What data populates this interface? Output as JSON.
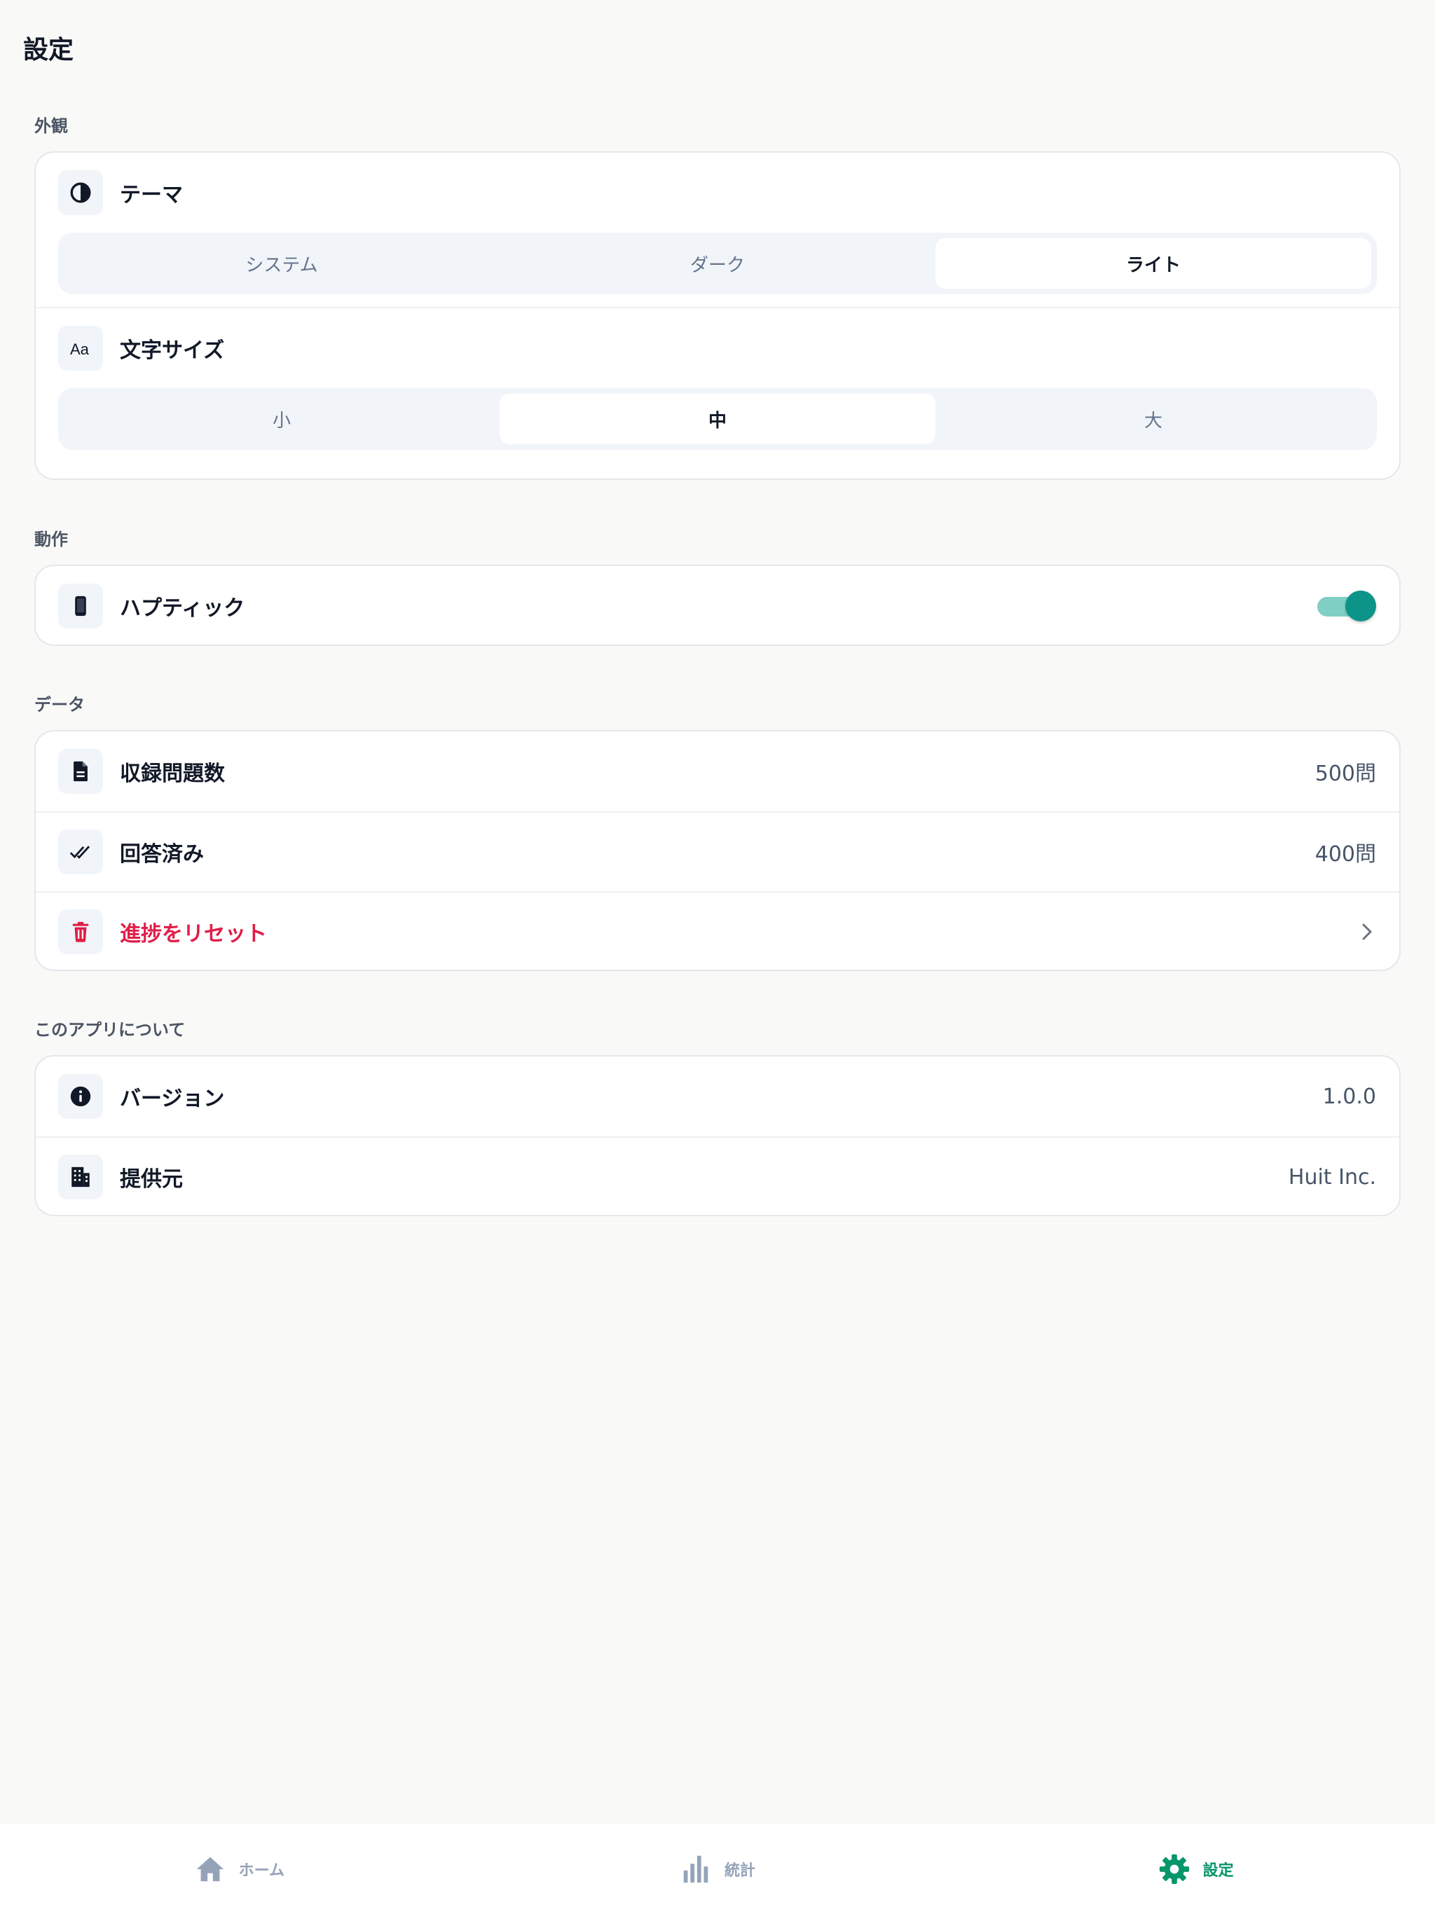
{
  "page": {
    "title": "設定"
  },
  "sections": {
    "appearance": {
      "label": "外観",
      "theme": {
        "label": "テーマ",
        "icon": "contrast-icon",
        "options": [
          "システム",
          "ダーク",
          "ライト"
        ],
        "selected": "ライト"
      },
      "font_size": {
        "label": "文字サイズ",
        "icon": "text-size-icon",
        "options": [
          "小",
          "中",
          "大"
        ],
        "selected": "中"
      }
    },
    "behavior": {
      "label": "動作",
      "haptic": {
        "label": "ハプティック",
        "icon": "phone-icon",
        "enabled": true
      }
    },
    "data": {
      "label": "データ",
      "total": {
        "label": "収録問題数",
        "icon": "document-icon",
        "value": "500問"
      },
      "answered": {
        "label": "回答済み",
        "icon": "double-check-icon",
        "value": "400問"
      },
      "reset": {
        "label": "進捗をリセット",
        "icon": "trash-icon"
      }
    },
    "about": {
      "label": "このアプリについて",
      "version": {
        "label": "バージョン",
        "icon": "info-icon",
        "value": "1.0.0"
      },
      "provider": {
        "label": "提供元",
        "icon": "building-icon",
        "value": "Huit Inc."
      }
    }
  },
  "tabbar": {
    "items": [
      {
        "label": "ホーム",
        "icon": "home-icon",
        "active": false
      },
      {
        "label": "統計",
        "icon": "bar-chart-icon",
        "active": false
      },
      {
        "label": "設定",
        "icon": "gear-icon",
        "active": true
      }
    ]
  },
  "colors": {
    "accent": "#059669",
    "toggle_on": "#0d9488",
    "danger": "#e11d48",
    "background": "#f9f9f8"
  }
}
